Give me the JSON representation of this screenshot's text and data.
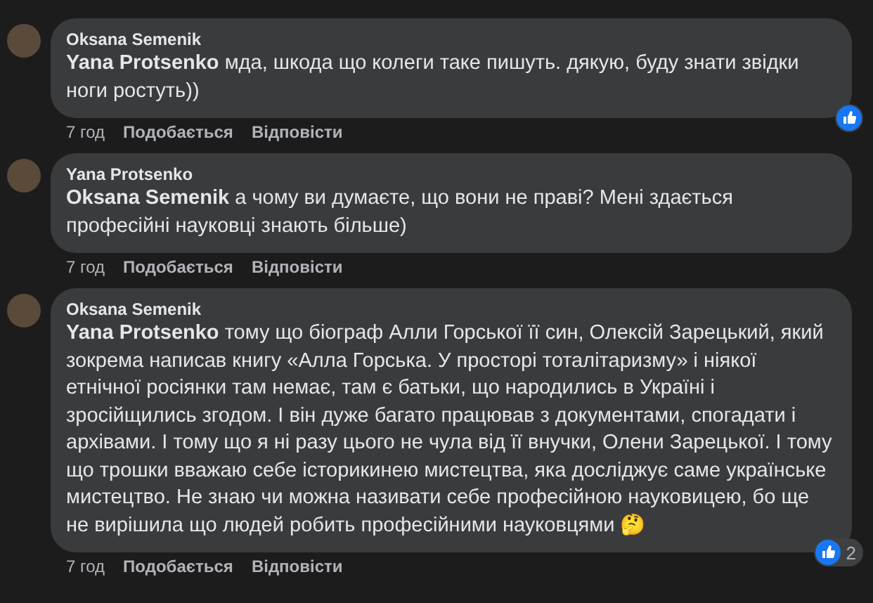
{
  "comments": [
    {
      "author": "Oksana Semenik",
      "text": "**Yana Protsenko** мда, шкода що колеги таке пишуть. дякую, буду знати звідки ноги ростуть))",
      "time": "7 год",
      "like": "Подобається",
      "reply": "Відповісти",
      "liked": true
    },
    {
      "author": "Yana Protsenko",
      "text": "**Oksana Semenik** а чому ви думаєте, що вони не праві? Мені здається професійні науковці знають більше)",
      "time": "7 год",
      "like": "Подобається",
      "reply": "Відповісти",
      "liked": false
    },
    {
      "author": "Oksana Semenik",
      "text": "**Yana Protsenko** тому що біограф Алли Горської її син, Олексій Зарецький, який зокрема написав книгу «Алла Горська. У просторі тоталітаризму» і ніякої етнічної росіянки там немає, там є батьки, що народились в Україні і зросійщились згодом. І він дуже багато працював з документами, спогадати і архівами. І тому що я ні разу цього не чула від її внучки, Олени Зарецької. І тому що трошки вважаю себе історикинею мистецтва, яка досліджує саме українське мистецтво. Не знаю чи можна називати себе професійною науковицею, бо ще не вирішила що людей робить професійними науковцями 🤔",
      "time": "7 год",
      "like": "Подобається",
      "reply": "Відповісти",
      "liked": true,
      "reaction_count": "2"
    }
  ]
}
